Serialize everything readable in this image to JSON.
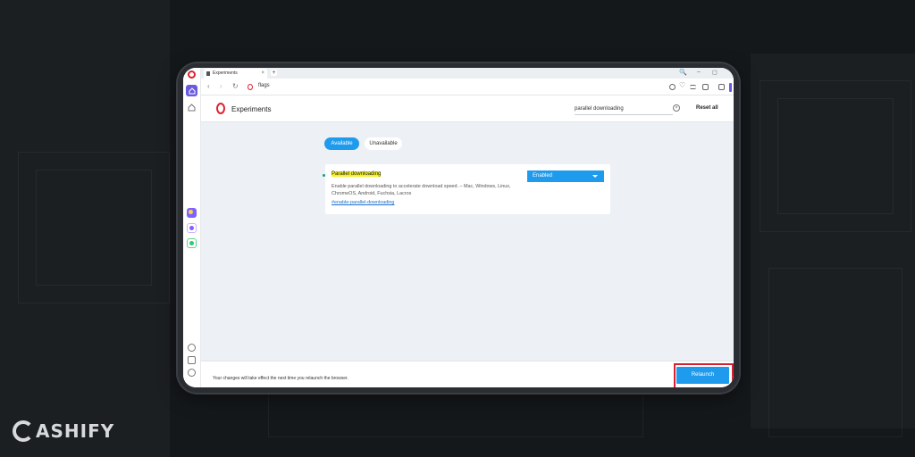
{
  "browser": {
    "tab_title": "Experiments",
    "tab_close": "×",
    "new_tab": "+",
    "window_controls": [
      "🔍",
      "–",
      "◻"
    ],
    "url": "flags"
  },
  "header": {
    "title": "Experiments",
    "search_value": "parallel downloading",
    "clear_icon": "×",
    "reset_label": "Reset all"
  },
  "tabs": {
    "available": "Available",
    "unavailable": "Unavailable"
  },
  "flag": {
    "name": "Parallel downloading",
    "description": "Enable parallel downloading to accelerate download speed. – Mac, Windows, Linux, ChromeOS, Android, Fuchsia, Lacros",
    "link": "#enable-parallel-downloading",
    "select_value": "Enabled"
  },
  "footer": {
    "message": "Your changes will take effect the next time you relaunch the browser.",
    "relaunch_label": "Relaunch"
  },
  "brand": {
    "name": "ASHIFY"
  },
  "colors": {
    "accent_blue": "#1f9bee",
    "opera_red": "#e0202c",
    "highlight_yellow": "#f4f02a",
    "callout_red": "#d8202e",
    "sidebar_purple": "#6a5ae0"
  },
  "icons": {
    "sidebar": [
      "opera-logo-icon",
      "home-icon",
      "home-outline-icon",
      "photos-icon",
      "messenger-icon",
      "whatsapp-icon",
      "settings-icon",
      "heart-icon",
      "history-icon"
    ],
    "addressbar": [
      "back-icon",
      "forward-icon",
      "reload-icon",
      "camera-icon",
      "heart-icon",
      "menu-icon",
      "lock-icon",
      "extensions-icon"
    ]
  }
}
